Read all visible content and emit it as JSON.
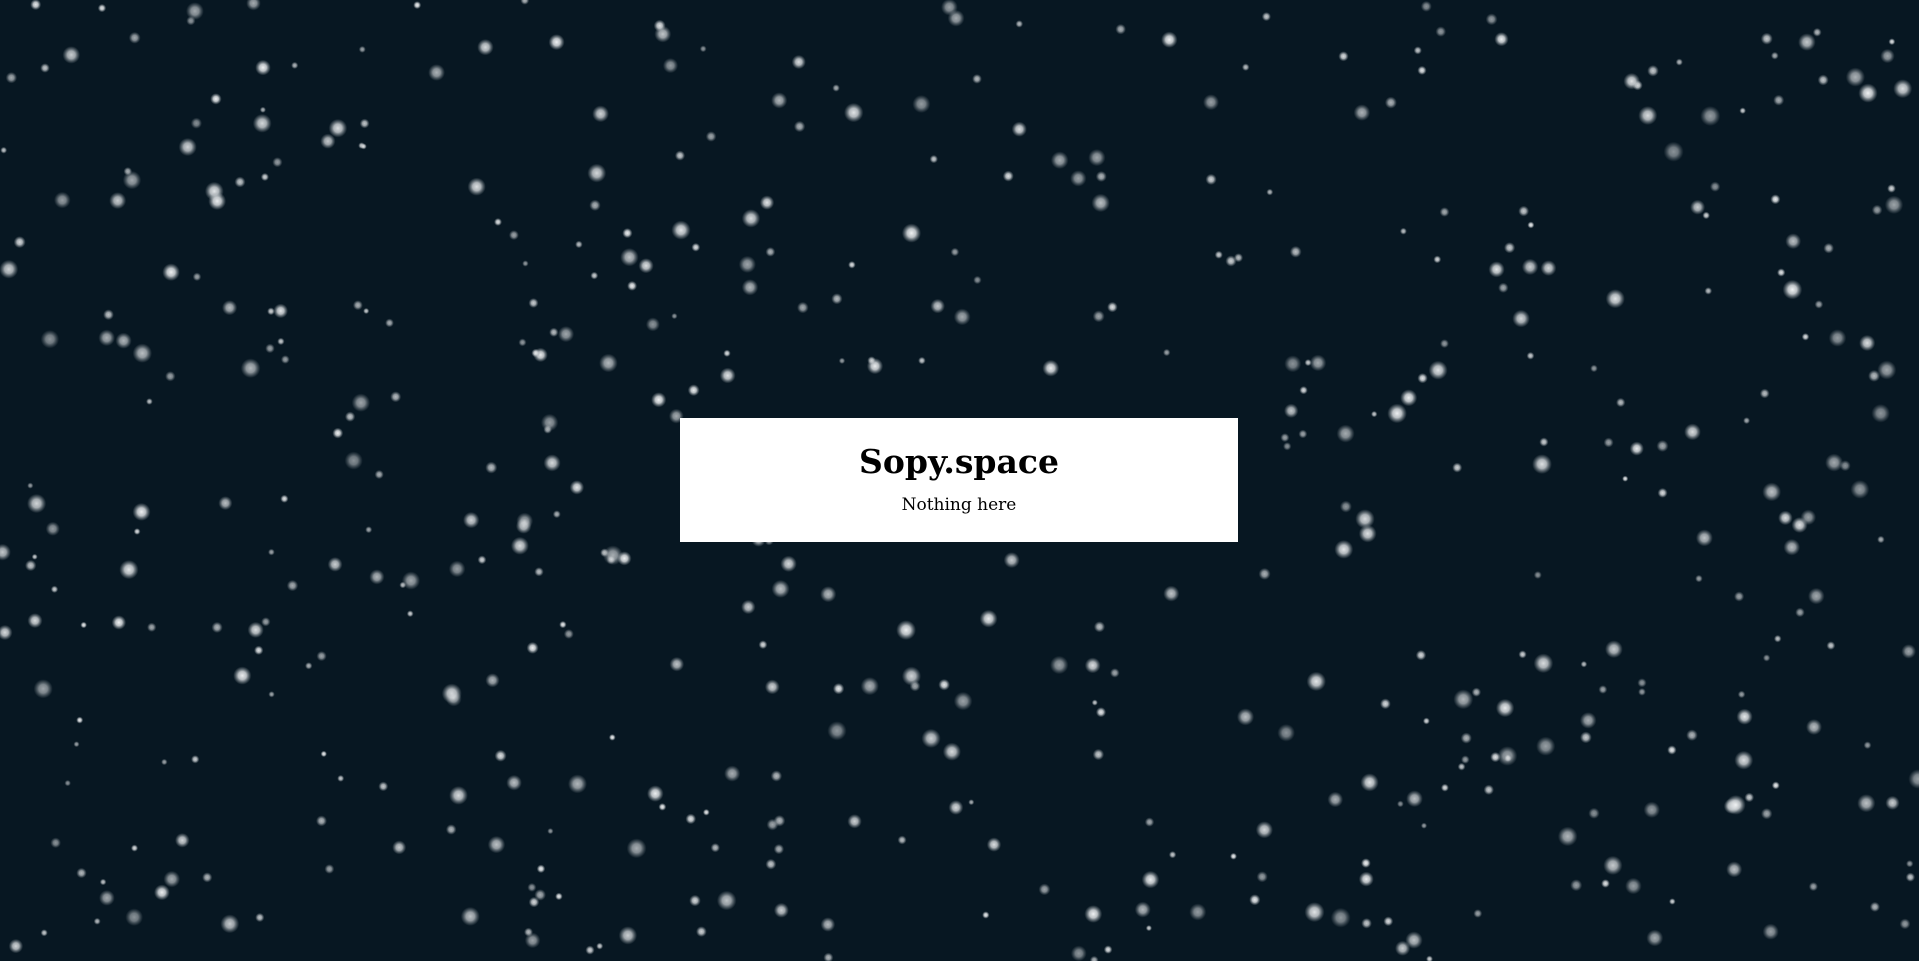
{
  "page": {
    "title": "Sopy.space",
    "message": "Nothing here"
  },
  "colors": {
    "background": "#071722",
    "star": "#d9dde0",
    "card_background": "#ffffff",
    "text": "#000000"
  }
}
